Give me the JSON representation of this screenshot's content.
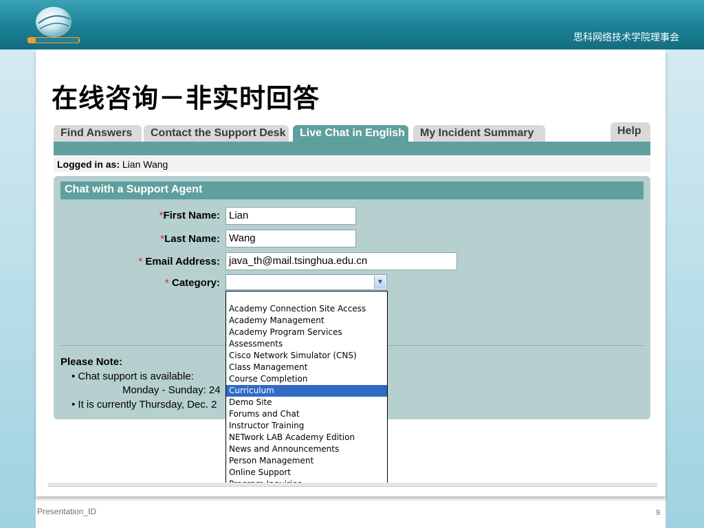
{
  "slide": {
    "org_name": "思科网络技术学院理事会",
    "title": "在线咨询－非实时回答",
    "footer_left": "Presentation_ID",
    "page_number": "9"
  },
  "tabs": [
    "Find Answers",
    "Contact the Support Desk",
    "Live Chat in English",
    "My Incident Summary"
  ],
  "active_tab": "Live Chat in English",
  "help_label": "Help",
  "logged_in": {
    "label": "Logged in as:",
    "user": "Lian Wang"
  },
  "chat_form": {
    "header": "Chat with a Support Agent",
    "required_mark": "*",
    "first_name": {
      "label": "First Name:",
      "value": "Lian"
    },
    "last_name": {
      "label": "Last Name:",
      "value": "Wang"
    },
    "email": {
      "label": "Email Address:",
      "value": "java_th@mail.tsinghua.edu.cn"
    },
    "category": {
      "label": "Category:",
      "value": ""
    }
  },
  "category_options": [
    "",
    "Academy Connection Site Access",
    "Academy Management",
    "Academy Program Services",
    "Assessments",
    "Cisco Network Simulator (CNS)",
    "Class Management",
    "Course Completion",
    "Curriculum",
    "Demo Site",
    "Forums and Chat",
    "Instructor Training",
    "NETwork LAB Academy Edition",
    "News and Announcements",
    "Person Management",
    "Online Support",
    "Program Inquiries"
  ],
  "highlighted_option": "Curriculum",
  "note": {
    "title": "Please Note:",
    "line1": "• Chat support is available:",
    "line2": "Monday - Sunday: 24",
    "line3": "• It is currently Thursday, Dec. 2"
  },
  "colors": {
    "tab_active": "#5f9f9e",
    "panel_bg": "#b6cfcf",
    "header_teal": "#1b8196",
    "selection_blue": "#316ac5",
    "required_red": "#e02020"
  }
}
